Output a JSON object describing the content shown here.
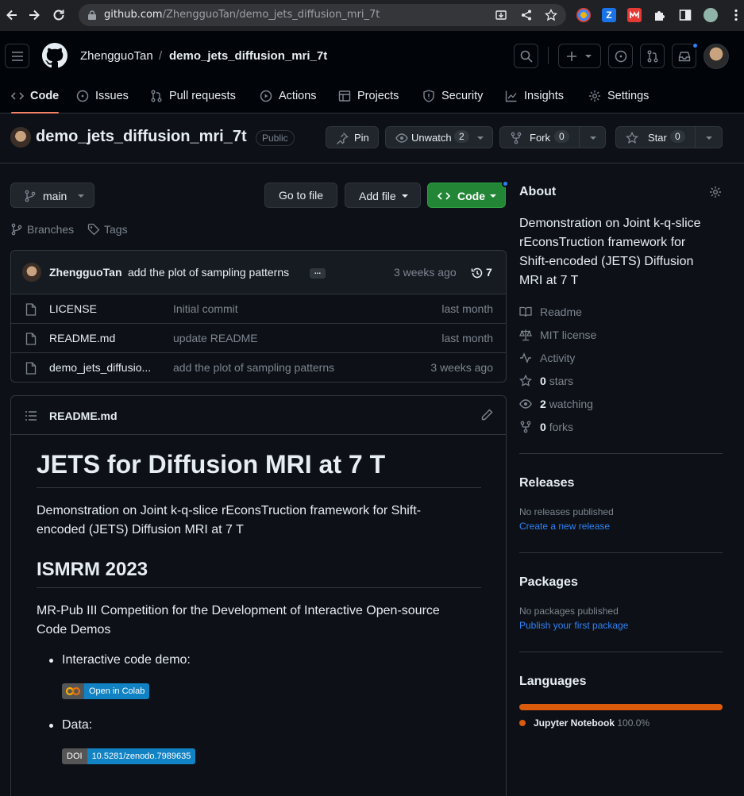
{
  "browser": {
    "url_host": "github.com",
    "url_path": "/ZhengguoTan/demo_jets_diffusion_mri_7t"
  },
  "header": {
    "owner": "ZhengguoTan",
    "separator": "/",
    "repo": "demo_jets_diffusion_mri_7t"
  },
  "tabs": [
    {
      "label": "Code",
      "icon": "code-icon"
    },
    {
      "label": "Issues",
      "icon": "issue-icon"
    },
    {
      "label": "Pull requests",
      "icon": "pull-request-icon"
    },
    {
      "label": "Actions",
      "icon": "play-icon"
    },
    {
      "label": "Projects",
      "icon": "table-icon"
    },
    {
      "label": "Security",
      "icon": "shield-icon"
    },
    {
      "label": "Insights",
      "icon": "graph-icon"
    },
    {
      "label": "Settings",
      "icon": "gear-icon"
    }
  ],
  "repo_title": {
    "name": "demo_jets_diffusion_mri_7t",
    "visibility": "Public",
    "pin": "Pin",
    "unwatch": "Unwatch",
    "watch_count": "2",
    "fork": "Fork",
    "fork_count": "0",
    "star": "Star",
    "star_count": "0"
  },
  "toolbar": {
    "branch": "main",
    "go_to_file": "Go to file",
    "add_file": "Add file",
    "code": "Code",
    "branches": "Branches",
    "tags": "Tags"
  },
  "commit": {
    "author": "ZhengguoTan",
    "message": "add the plot of sampling patterns",
    "ellipsis": "...",
    "time": "3 weeks ago",
    "count": "7"
  },
  "files": [
    {
      "name": "LICENSE",
      "message": "Initial commit",
      "time": "last month"
    },
    {
      "name": "README.md",
      "message": "update README",
      "time": "last month"
    },
    {
      "name": "demo_jets_diffusio...",
      "message": "add the plot of sampling patterns",
      "time": "3 weeks ago"
    }
  ],
  "readme": {
    "filename": "README.md",
    "h1": "JETS for Diffusion MRI at 7 T",
    "intro_line1": "Demonstration on Joint k-q-slice rEconsTruction framework for Shift-",
    "intro_line2": "encoded (JETS) Diffusion MRI at 7 T",
    "h2": "ISMRM 2023",
    "p2_line1": "MR-Pub III Competition for the Development of Interactive Open-source",
    "p2_line2": "Code Demos",
    "bullet1": "Interactive code demo:",
    "colab_badge": "Open in Colab",
    "bullet2": "Data:",
    "doi_label": "DOI",
    "doi_value": "10.5281/zenodo.7989635"
  },
  "about": {
    "title": "About",
    "desc_line1": "Demonstration on Joint k-q-slice",
    "desc_line2": "rEconsTruction framework for",
    "desc_line3": "Shift-encoded (JETS) Diffusion",
    "desc_line4": "MRI at 7 T",
    "readme": "Readme",
    "license": "MIT license",
    "activity": "Activity",
    "stars_num": "0",
    "stars_label": "stars",
    "watching_num": "2",
    "watching_label": "watching",
    "forks_num": "0",
    "forks_label": "forks"
  },
  "releases": {
    "title": "Releases",
    "none": "No releases published",
    "create": "Create a new release"
  },
  "packages": {
    "title": "Packages",
    "none": "No packages published",
    "publish": "Publish your first package"
  },
  "languages": {
    "title": "Languages",
    "items": [
      {
        "name": "Jupyter Notebook",
        "percent": "100.0%",
        "color": "#DA5B0B",
        "share": 1.0
      }
    ]
  },
  "colors": {
    "accent_green": "#238636",
    "link_blue": "#2f81f7",
    "tab_underline": "#f78166"
  }
}
